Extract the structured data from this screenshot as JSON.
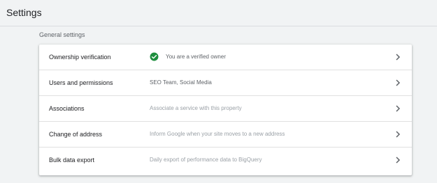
{
  "header": {
    "title": "Settings"
  },
  "section": {
    "heading": "General settings"
  },
  "rows": [
    {
      "label": "Ownership verification",
      "value": "You are a verified owner",
      "icon": "check-circle-icon"
    },
    {
      "label": "Users and permissions",
      "value": "SEO Team, Social Media"
    },
    {
      "label": "Associations",
      "value": "Associate a service with this property"
    },
    {
      "label": "Change of address",
      "value": "Inform Google when your site moves to a new address"
    },
    {
      "label": "Bulk data export",
      "value": "Daily export of performance data to BigQuery"
    }
  ],
  "colors": {
    "verified": "#1e8e3e",
    "background": "#f1f3f4"
  }
}
